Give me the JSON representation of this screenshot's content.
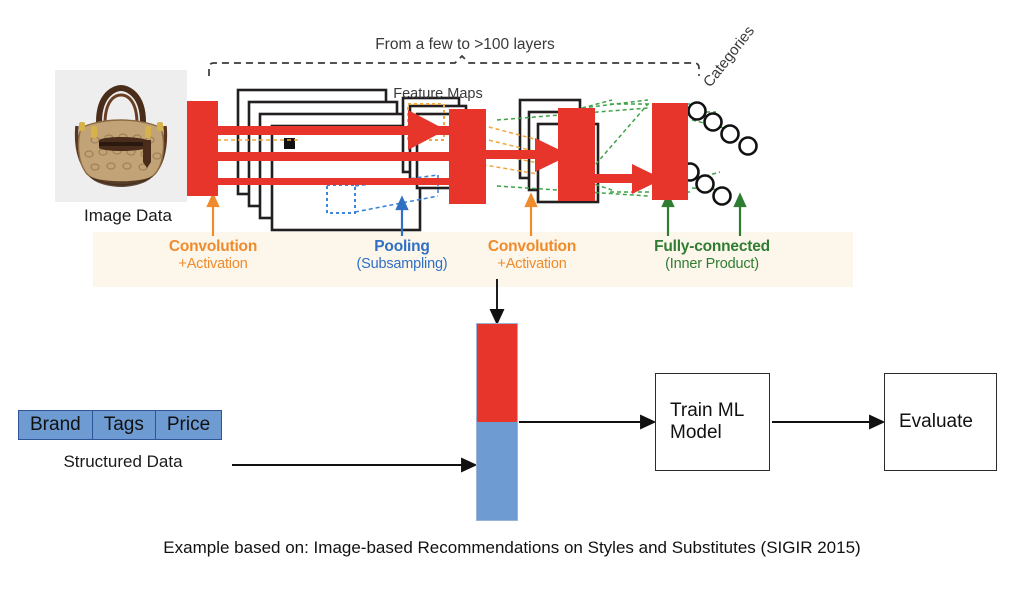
{
  "diagram": {
    "title_note": "From a few to >100 layers",
    "feature_maps_label": "Feature Maps",
    "categories_label": "Categories",
    "image_caption": "Image Data",
    "structured_caption": "Structured Data",
    "footer": "Example based on: Image-based Recommendations on Styles and Substitutes (SIGIR 2015)"
  },
  "stages": [
    {
      "line1": "Convolution",
      "line2": "+Activation",
      "color": "#ef8b2c",
      "paren": false
    },
    {
      "line1": "Pooling",
      "line2": "(Subsampling)",
      "color": "#2f6fc4",
      "paren": true
    },
    {
      "line1": "Convolution",
      "line2": "+Activation",
      "color": "#ef8b2c",
      "paren": false
    },
    {
      "line1": "Fully-connected",
      "line2": "(Inner Product)",
      "color": "#2e7d32",
      "paren": true
    }
  ],
  "structured_table": {
    "headers": [
      "Brand",
      "Tags",
      "Price"
    ]
  },
  "pipeline": {
    "train_box": "Train ML\nModel",
    "train_box_line1": "Train ML",
    "train_box_line2": "Model",
    "evaluate_box": "Evaluate"
  },
  "colors": {
    "red": "#e8352b",
    "blue": "#6e9bd1",
    "orange": "#ef8b2c",
    "green": "#2e7d32",
    "band": "#fdf6ea",
    "table_border": "#2f5597"
  },
  "icons": {
    "handbag": "handbag-photo",
    "arrow_right": "arrow-right-icon",
    "arrow_up": "arrow-up-icon",
    "arrow_down": "arrow-down-icon"
  }
}
